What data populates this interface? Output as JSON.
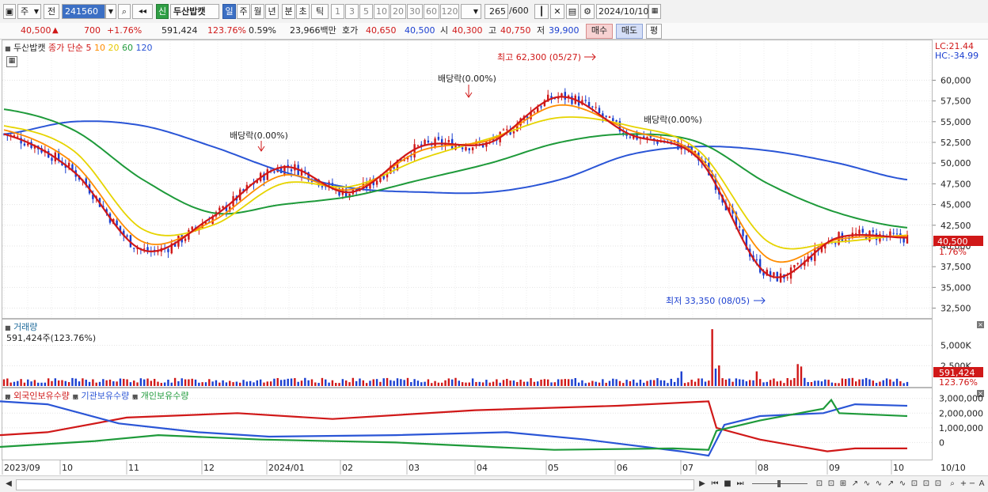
{
  "toolbar": {
    "market_select": "주",
    "prefix_label": "전",
    "code_input": "241560",
    "new_badge": "신",
    "stock_name": "두산밥캣",
    "periods": [
      "일",
      "주",
      "월",
      "년",
      "분",
      "초",
      "틱"
    ],
    "active_period": "일",
    "intervals": [
      "1",
      "3",
      "5",
      "10",
      "20",
      "30",
      "60",
      "120"
    ],
    "count_value": "265",
    "count_total": "/600",
    "date_value": "2024/10/10"
  },
  "info": {
    "price": "40,500",
    "arrow": "▲",
    "change": "700",
    "change_pct": "+1.76%",
    "volume": "591,424",
    "volume_pct": "123.76%",
    "turnover_pct": "0.59%",
    "amount": "23,966백만",
    "quote_label": "호가",
    "ask": "40,650",
    "bid": "40,500",
    "open_label": "시",
    "open": "40,300",
    "high_label": "고",
    "high": "40,750",
    "low_label": "저",
    "low": "39,900",
    "buy_button": "매수",
    "sell_button": "매도",
    "eval_button": "평"
  },
  "price_panel": {
    "name": "두산밥캣",
    "ma_label": "종가 단순",
    "ma_periods": [
      "5",
      "10",
      "20",
      "60",
      "120"
    ],
    "ma_colors": [
      "#d01818",
      "#ff8c00",
      "#e6d400",
      "#1e9a3a",
      "#2a55d6"
    ],
    "lc": "LC:21.44",
    "hc": "HC:-34.99",
    "y_ticks": [
      "60,000",
      "57,500",
      "55,000",
      "52,500",
      "50,000",
      "47,500",
      "45,000",
      "42,500",
      "40,000",
      "37,500",
      "35,000",
      "32,500"
    ],
    "current_price_tag": "40,500",
    "current_pct_tag": "1.76%",
    "high_annotation": "최고 62,300 (05/27)",
    "low_annotation": "최저 33,350 (08/05)",
    "dividend_1": "배당락(0.00%)",
    "dividend_2": "배당락(0.00%)",
    "dividend_3": "배당락(0.00%)"
  },
  "volume_panel": {
    "title": "거래량",
    "subtitle": "591,424주(123.76%)",
    "y_ticks": [
      "5,000K",
      "2,500K"
    ],
    "current_tag": "591,424",
    "current_pct_tag": "123.76%"
  },
  "holdings_panel": {
    "series": [
      "외국인보유수량",
      "기관보유수량",
      "개인보유수량"
    ],
    "colors": [
      "#d01818",
      "#2a55d6",
      "#1e9a3a"
    ],
    "y_ticks": [
      "3,000,000",
      "2,000,000",
      "1,000,000",
      "0"
    ]
  },
  "x_axis": {
    "labels": [
      "2023/09",
      "10",
      "11",
      "12",
      "2024/01",
      "02",
      "03",
      "04",
      "05",
      "06",
      "07",
      "08",
      "09",
      "10",
      "10/10"
    ]
  },
  "chart_data": {
    "type": "line",
    "x": [
      "2023/09",
      "2023/10",
      "2023/11",
      "2023/12",
      "2024/01",
      "2024/02",
      "2024/03",
      "2024/04",
      "2024/05",
      "2024/06",
      "2024/07",
      "2024/08",
      "2024/09",
      "2024/10"
    ],
    "series": [
      {
        "name": "5",
        "values": [
          53500,
          49000,
          39500,
          43500,
          49500,
          46500,
          52000,
          52500,
          58000,
          53500,
          50500,
          36500,
          41000,
          41000
        ]
      },
      {
        "name": "10",
        "values": [
          54000,
          50000,
          40500,
          43000,
          48500,
          46800,
          51500,
          52800,
          57000,
          54000,
          50800,
          38500,
          40800,
          41200
        ]
      },
      {
        "name": "20",
        "values": [
          54500,
          51500,
          42000,
          42500,
          47500,
          47200,
          50500,
          53000,
          55500,
          54500,
          51500,
          40500,
          40500,
          41300
        ]
      },
      {
        "name": "60",
        "values": [
          56500,
          54000,
          48000,
          44000,
          45000,
          46000,
          48000,
          50000,
          52500,
          53500,
          52500,
          47500,
          44000,
          42200
        ]
      },
      {
        "name": "120",
        "values": [
          53500,
          55000,
          54500,
          52000,
          49000,
          47000,
          46500,
          46500,
          48000,
          51000,
          52000,
          51500,
          50000,
          48000
        ]
      }
    ],
    "ylim": [
      31500,
      63000
    ],
    "annotations": [
      "최고 62,300 (05/27)",
      "최저 33,350 (08/05)"
    ]
  }
}
